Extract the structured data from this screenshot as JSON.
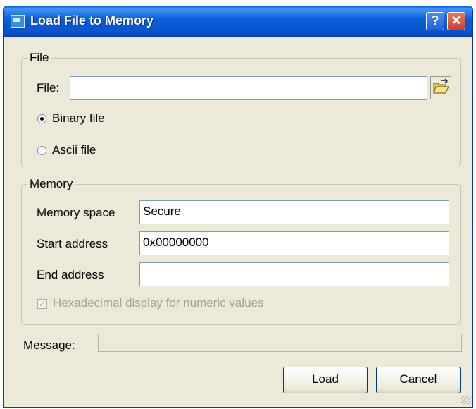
{
  "window": {
    "title": "Load File to Memory",
    "help_label": "?",
    "close_label": "✕"
  },
  "file_group": {
    "legend": "File",
    "file_label": "File:",
    "file_value": "",
    "browse_icon": "folder-open-icon",
    "options": [
      {
        "label": "Binary file",
        "selected": true
      },
      {
        "label": "Ascii file",
        "selected": false
      }
    ]
  },
  "memory_group": {
    "legend": "Memory",
    "memory_space_label": "Memory space",
    "memory_space_value": "Secure",
    "start_address_label": "Start address",
    "start_address_value": "0x00000000",
    "end_address_label": "End address",
    "end_address_value": "",
    "hex_display_label": "Hexadecimal display for numeric values",
    "hex_display_checked": true,
    "hex_display_enabled": false
  },
  "message": {
    "label": "Message:",
    "value": ""
  },
  "buttons": {
    "load": "Load",
    "cancel": "Cancel"
  },
  "colors": {
    "titlebar": "#0a5fd8",
    "dialog_bg": "#ece9d8",
    "close_button": "#c8452c"
  }
}
